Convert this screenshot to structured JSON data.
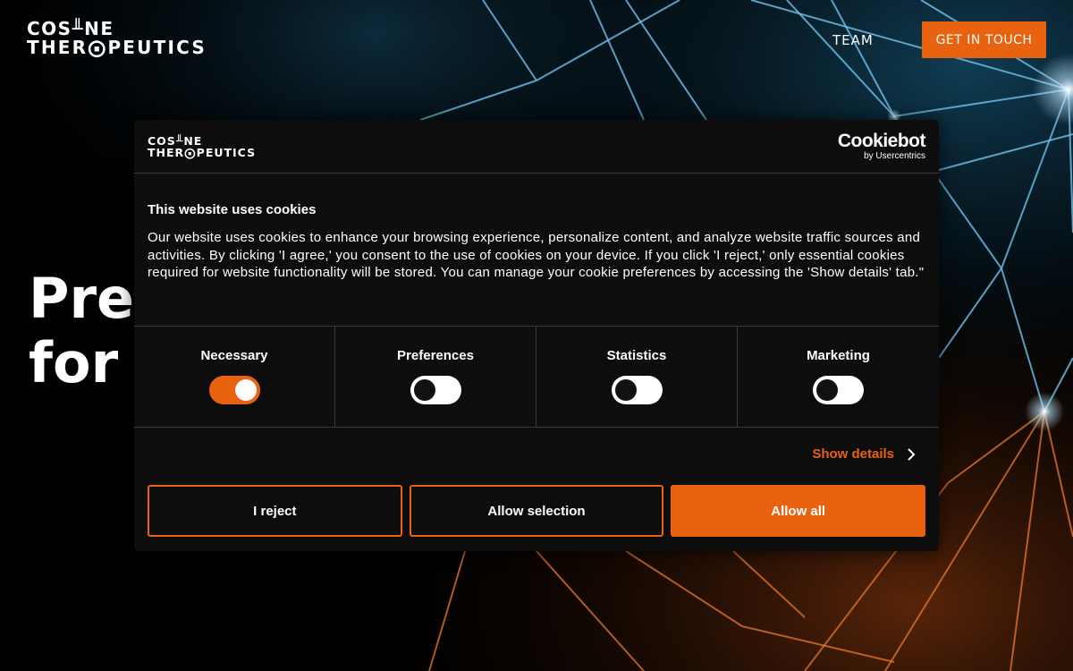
{
  "header": {
    "logo_line1": "COS╨NE",
    "logo_line2": "THER⨀PEUTICS",
    "nav_team": "TEAM",
    "cta_label": "GET IN TOUCH"
  },
  "hero": {
    "line1": "Prec",
    "line2": "for b"
  },
  "cookie_dialog": {
    "logo_line1": "COS╨NE",
    "logo_line2": "THER⨀PEUTICS",
    "provider_brand": "Cookiebot",
    "provider_by": "by Usercentrics",
    "title": "This website uses cookies",
    "text": "Our website uses cookies to enhance your browsing experience, personalize content, and analyze website traffic sources and activities. By clicking 'I agree,' you consent to the use of cookies on your device. If you click 'I reject,' only essential cookies required for website functionality will be stored. You can manage your cookie preferences by accessing the 'Show details' tab.\"",
    "toggles": [
      {
        "label": "Necessary",
        "on": true
      },
      {
        "label": "Preferences",
        "on": false
      },
      {
        "label": "Statistics",
        "on": false
      },
      {
        "label": "Marketing",
        "on": false
      }
    ],
    "show_details": "Show details",
    "buttons": {
      "reject": "I reject",
      "allow_selection": "Allow selection",
      "allow_all": "Allow all"
    }
  },
  "colors": {
    "accent": "#e8620f",
    "background": "#000000",
    "dialog": "#0d0d0d",
    "network_blue": "#6fc3ee",
    "network_orange": "#e8782a"
  }
}
